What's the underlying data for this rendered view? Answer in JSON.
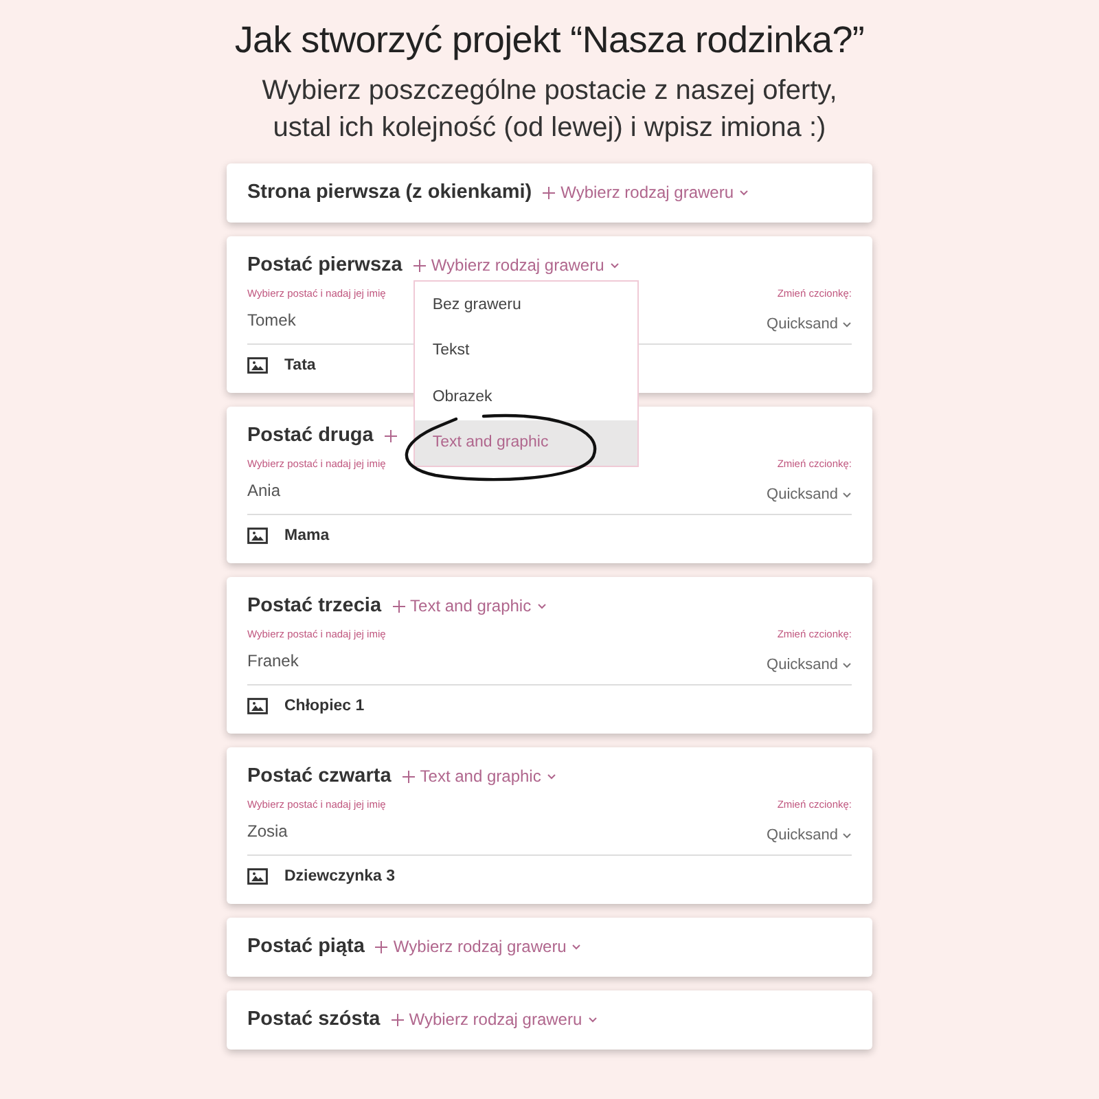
{
  "heading": "Jak stworzyć projekt “Nasza rodzinka?”",
  "subheading": "Wybierz poszczególne postacie z naszej oferty,\nustal ich kolejność (od lewej) i wpisz imiona :)",
  "cards": [
    {
      "kind": "header",
      "title": "Strona pierwsza (z okienkami)",
      "choice": "Wybierz rodzaj graweru"
    },
    {
      "kind": "character",
      "title": "Postać pierwsza",
      "choice": "Wybierz rodzaj graweru",
      "hint": "Wybierz postać i nadaj jej imię",
      "font_label": "Zmień czcionkę:",
      "name": "Tomek",
      "font": "Quicksand",
      "figure": "Tata",
      "dropdown": {
        "options": [
          {
            "label": "Bez graweru",
            "selected": false
          },
          {
            "label": "Tekst",
            "selected": false
          },
          {
            "label": "Obrazek",
            "selected": false
          },
          {
            "label": "Text and graphic",
            "selected": true
          }
        ]
      }
    },
    {
      "kind": "character",
      "title": "Postać druga",
      "hint": "Wybierz postać i nadaj jej imię",
      "font_label": "Zmień czcionkę:",
      "name": "Ania",
      "font": "Quicksand",
      "figure": "Mama"
    },
    {
      "kind": "character",
      "title": "Postać trzecia",
      "choice": "Text and graphic",
      "hint": "Wybierz postać i nadaj jej imię",
      "font_label": "Zmień czcionkę:",
      "name": "Franek",
      "font": "Quicksand",
      "figure": "Chłopiec 1"
    },
    {
      "kind": "character",
      "title": "Postać czwarta",
      "choice": "Text and graphic",
      "hint": "Wybierz postać i nadaj jej imię",
      "font_label": "Zmień czcionkę:",
      "name": "Zosia",
      "font": "Quicksand",
      "figure": "Dziewczynka 3"
    },
    {
      "kind": "header",
      "title": "Postać piąta",
      "choice": "Wybierz rodzaj graweru"
    },
    {
      "kind": "header",
      "title": "Postać szósta",
      "choice": "Wybierz rodzaj graweru"
    }
  ]
}
